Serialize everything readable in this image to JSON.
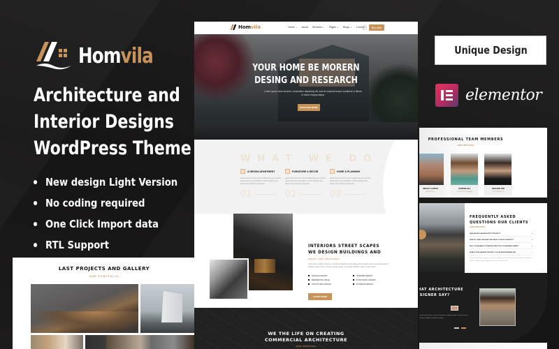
{
  "brand": {
    "name_main": "Hom",
    "name_accent": "vila",
    "accent_color": "#c7935a",
    "background_color": "#1a1919"
  },
  "promo": {
    "headline": [
      "Architecture and",
      "Interior Designs",
      "WordPress Theme"
    ],
    "features": [
      "New design Light Version",
      "No coding required",
      "One Click Import data",
      "RTL Support"
    ],
    "unique_badge": "Unique Design",
    "builder_name": "elementor"
  },
  "gallery": {
    "title": "LAST PROJECTS AND GALLERY",
    "subtitle": "OUR PORTFOLIO"
  },
  "site": {
    "nav": {
      "logo_main": "Hom",
      "logo_accent": "vila",
      "items": [
        "Home ⌄",
        "About",
        "Services ⌄",
        "Pages ⌄",
        "Blogs ⌄",
        "Contact"
      ],
      "buy_label": "Buy Now"
    },
    "hero": {
      "title_line1": "YOUR HOME BE MORERN",
      "title_line2": "DESING AND RESEARCH",
      "text": "Lorem ipsum dolor sit amet, consectetur adipiscing elit, sed do eiusmod tempor incididunt ut labore et dolore magna aliqua.",
      "button": "DISCOVER MORE"
    },
    "what_we_do": {
      "title": "WHAT WE DO",
      "services": [
        {
          "name": "A DESIGN APARTMENT",
          "text": "Ipsum dolor sit amet, dictum adipiscing elit, sed do eiusmod tempor incididunt ut labore dolore gna aliqua quis nostrud consequat.",
          "num": "01"
        },
        {
          "name": "FURNITURE & DECOR",
          "text": "Ipsum dolor sit amet, dictum adipiscing elit, sed do eiusmod tempor incididunt ut labore dolore gna aliqua quis nostrud consequat.",
          "num": "02"
        },
        {
          "name": "HOME & PLANNING",
          "text": "Ipsum dolor sit amet, dictum adipiscing elit, sed do eiusmod tempor incididunt ut labore dolore gna aliqua quis nostrud consequat.",
          "num": "03"
        }
      ]
    },
    "interiors": {
      "title_line1": "INTERIORS STREET SCAPES",
      "title_line2": "WE DESIGN BUILDINGS AND",
      "subtitle": "ABOUT THE ARCHITECT",
      "text": "Lorem ipsum dolor sit amet, consectetur adipiscing elit. Suspendisse varius enim in eros elementum tristique. Duis cursus, mi quis viverra ornare, eros dolor interdum nulla, ut commodo.",
      "list_left": [
        "SPACE PLANNING",
        "RESIDENTIAL SPACE",
        "STRUCTURAL DESIGN"
      ],
      "list_right": [
        "INTERIOR DESIGN",
        "FUNCTIONAL AFFAIRS",
        "EXTERIOR DESIGN"
      ],
      "button": "LEARN MORE"
    },
    "commercial": {
      "title_line1": "WE THE LIFE ON CREATING",
      "title_line2": "COMMERCIAL ARCHITECTURE",
      "subtitle": "OUR SERVICES"
    }
  },
  "right_panel": {
    "team": {
      "title": "PROFESSIONAL TEAM MEMBERS",
      "subtitle": "MEET WITH TEAM",
      "members": [
        {
          "name": "WESLEY CARTER",
          "role": "ARCHITECT"
        },
        {
          "name": "RAMONE HILL",
          "role": "INTERIOR DESIGNER"
        },
        {
          "name": "RICHARD TOM",
          "role": "CEO DIRECTOR"
        }
      ]
    },
    "faq": {
      "title_line1": "FREQUENTLY ASKED",
      "title_line2": "QUESTIONS OUR CLIENTS",
      "subtitle": "QUESTIONS FROM",
      "questions": [
        "HOW SHOULD AN ARCHITECT PROJECT?",
        "HOW DO I FIND THE RIGHT ARCHITECT FOR MY PROJECT?",
        "WILL YOU BE ABLE TO DESIGN THE STYLE OF BUILDING I WANT?",
        "WHAT'S THE LARGEST PROJECT YOU'VE EVER WORKED ON?"
      ],
      "answer": "Lorem ipsum dolor sit amet, consectetur adipiscing elit, sed do eiusmod tempor incididunt ut labore et dolore magna aliqua. Ut enim ad minim veniam."
    },
    "testimonial": {
      "title_line1": "WHAT ARCHITECTURE",
      "title_line2": "DESIGNER SAY?",
      "text": "Lorem ipsum dolor sit amet, consectetur adipiscing elit, sed do eiusmod tempor incididunt ut labore et dolore."
    }
  }
}
